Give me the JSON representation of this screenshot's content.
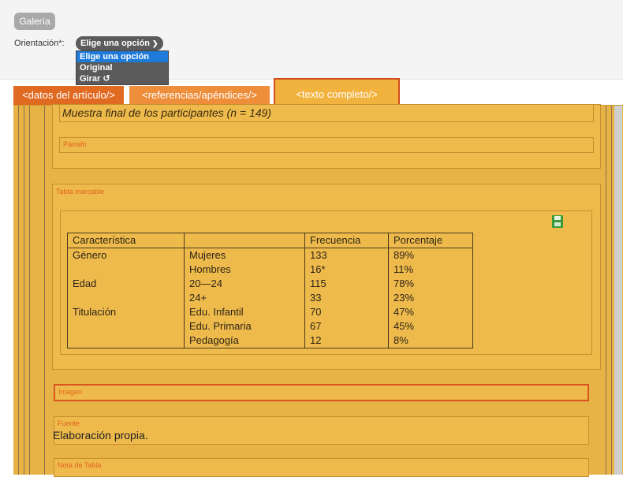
{
  "toolbar": {
    "gallery_label": "Galería"
  },
  "orientation": {
    "label": "Orientación*:",
    "selected": "Elige una opción",
    "options": [
      "Elige una opción",
      "Original",
      "Girar ↺"
    ]
  },
  "tabs": [
    "<datos del artículo/>",
    "<referencias/apéndices/>",
    "<texto completo/>"
  ],
  "editor": {
    "caption_text": "Muestra final de los participantes (n = 149)",
    "paragraph_label": "Párrafo",
    "table_label": "Tabla marcable",
    "image_label": "Imagen",
    "source_label": "Fuente",
    "source_text": "Elaboración propia.",
    "note_label": "Nota de Tabla",
    "save_icon": "save-icon"
  },
  "table": {
    "headers": [
      "Característica",
      "",
      "Frecuencia",
      "Porcentaje"
    ],
    "rows": [
      [
        "Género",
        "Mujeres",
        "133",
        "89%"
      ],
      [
        "",
        "Hombres",
        "16*",
        "11%"
      ],
      [
        "Edad",
        "20—24",
        "115",
        "78%"
      ],
      [
        "",
        "24+",
        "33",
        "23%"
      ],
      [
        "Titulación",
        "Edu. Infantil",
        "70",
        "47%"
      ],
      [
        "",
        "Edu. Primaria",
        "67",
        "45%"
      ],
      [
        "",
        "Pedagogía",
        "12",
        "8%"
      ]
    ]
  },
  "colors": {
    "tab_active_border": "#d14d1e",
    "content_background": "#e8b346",
    "dropdown_highlight": "#1e7bd9"
  }
}
